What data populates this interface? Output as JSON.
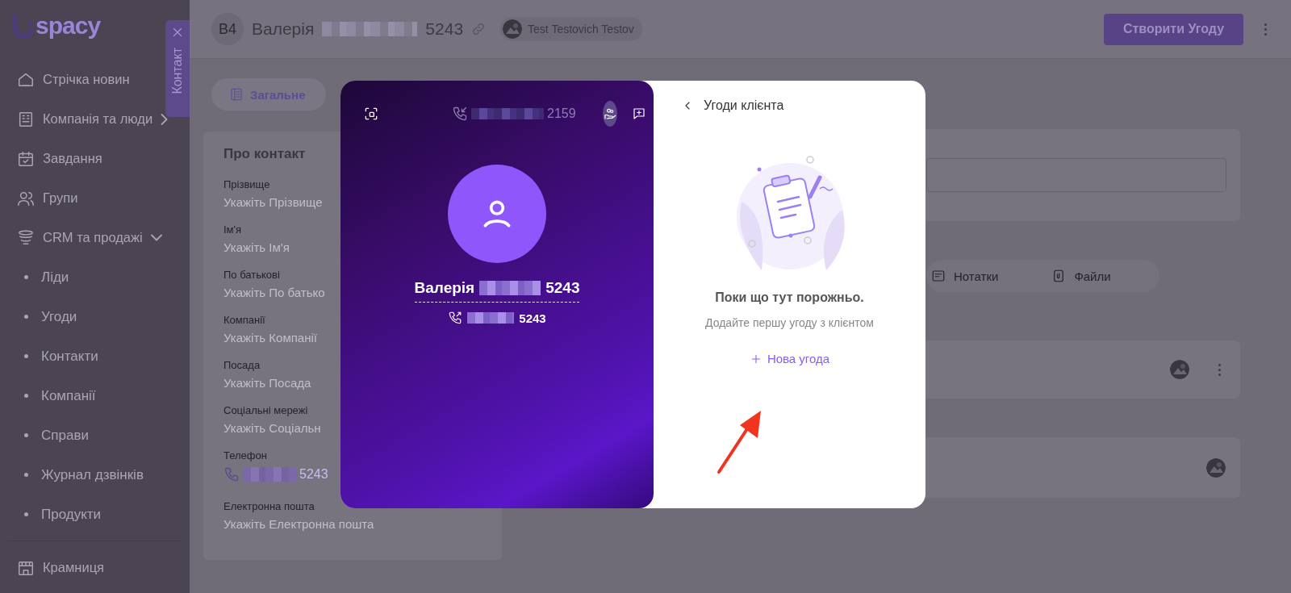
{
  "sidebar": {
    "logo_text": "spacy",
    "items": [
      {
        "label": "Стрічка новин"
      },
      {
        "label": "Компанія та люди",
        "expanded": false
      },
      {
        "label": "Завдання"
      },
      {
        "label": "Групи"
      },
      {
        "label": "CRM та продажі",
        "expanded": true,
        "children": [
          {
            "label": "Ліди"
          },
          {
            "label": "Угоди"
          },
          {
            "label": "Контакти"
          },
          {
            "label": "Компанії"
          },
          {
            "label": "Справи"
          },
          {
            "label": "Журнал дзвінків"
          },
          {
            "label": "Продукти"
          }
        ]
      }
    ],
    "footer_items": [
      {
        "label": "Крамниця"
      }
    ]
  },
  "side_tab": {
    "label": "Контакт"
  },
  "header": {
    "avatar_initials": "В4",
    "name": "Валерія",
    "name_digits": "5243",
    "owner": "Test Testovich Testov",
    "create_button": "Створити Угоду"
  },
  "tabs": [
    {
      "label": "Загальне",
      "selected": true
    }
  ],
  "contact_card": {
    "title": "Про контакт",
    "fields": [
      {
        "label": "Прізвище",
        "placeholder": "Укажіть Прізвище"
      },
      {
        "label": "Ім'я",
        "placeholder": "Укажіть Ім'я"
      },
      {
        "label": "По батькові",
        "placeholder": "Укажіть По батько"
      },
      {
        "label": "Компанії",
        "placeholder": "Укажіть Компанії"
      },
      {
        "label": "Посада",
        "placeholder": "Укажіть Посада"
      },
      {
        "label": "Соціальні мережі",
        "placeholder": "Укажіть Соціальн"
      },
      {
        "label": "Телефон",
        "kind": "phone",
        "value": "5243"
      },
      {
        "label": "Електронна пошта",
        "placeholder": "Укажіть Електронна пошта"
      }
    ]
  },
  "activity_tabs": [
    {
      "label": "Нотатки",
      "selected": false
    },
    {
      "label": "Файли",
      "selected": false
    }
  ],
  "call_panel": {
    "incoming_digits": "2159",
    "caller_name": "Валерія",
    "caller_digits": "5243",
    "phone_digits": "5243"
  },
  "deals_panel": {
    "title": "Угоди клієнта",
    "empty_title": "Поки що тут порожньо.",
    "empty_subtitle": "Додайте першу угоду з клієнтом",
    "new_button": "Нова угода"
  }
}
